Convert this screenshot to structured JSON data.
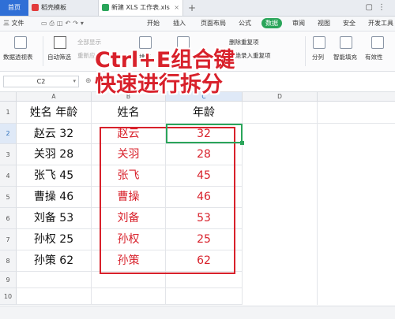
{
  "tabs": [
    {
      "label": "首页"
    },
    {
      "label": "稻壳模板"
    },
    {
      "label": "新建 XLS 工作表.xls"
    }
  ],
  "menu": {
    "file": "三 文件",
    "items": [
      "开始",
      "插入",
      "页面布局",
      "公式",
      "数据",
      "审阅",
      "视图",
      "安全",
      "开发工具"
    ],
    "active": "数据"
  },
  "ribbon": {
    "pivot": "数据透视表",
    "autofilter": "自动筛选",
    "show_all": "全部显示",
    "reapply": "重新应用",
    "sort": "排序",
    "highlight_dup": "高亮重复项",
    "delete_dup": "删除重复项",
    "reject_dup": "拒绝录入重复项",
    "split": "分列",
    "smart_fill": "智能填充",
    "validity": "有效性"
  },
  "caption": {
    "line1": "Ctrl+E组合键",
    "line2": "快速进行拆分"
  },
  "formula_bar": {
    "name_box": "C2",
    "fx": "⊕ fx"
  },
  "columns": [
    "A",
    "B",
    "C",
    "D"
  ],
  "rows": [
    "1",
    "2",
    "3",
    "4",
    "5",
    "6",
    "7",
    "8",
    "9",
    "10"
  ],
  "table": {
    "header": {
      "a": "姓名 年龄",
      "b": "姓名",
      "c": "年龄"
    },
    "data": [
      {
        "a": "赵云 32",
        "b": "赵云",
        "c": "32"
      },
      {
        "a": "关羽 28",
        "b": "关羽",
        "c": "28"
      },
      {
        "a": "张飞 45",
        "b": "张飞",
        "c": "45"
      },
      {
        "a": "曹操 46",
        "b": "曹操",
        "c": "46"
      },
      {
        "a": "刘备 53",
        "b": "刘备",
        "c": "53"
      },
      {
        "a": "孙权 25",
        "b": "孙权",
        "c": "25"
      },
      {
        "a": "孙策 62",
        "b": "孙策",
        "c": "62"
      }
    ]
  },
  "colors": {
    "accent": "#2aa55a",
    "highlight": "#d8212b",
    "home_tab": "#2f6fd6"
  }
}
